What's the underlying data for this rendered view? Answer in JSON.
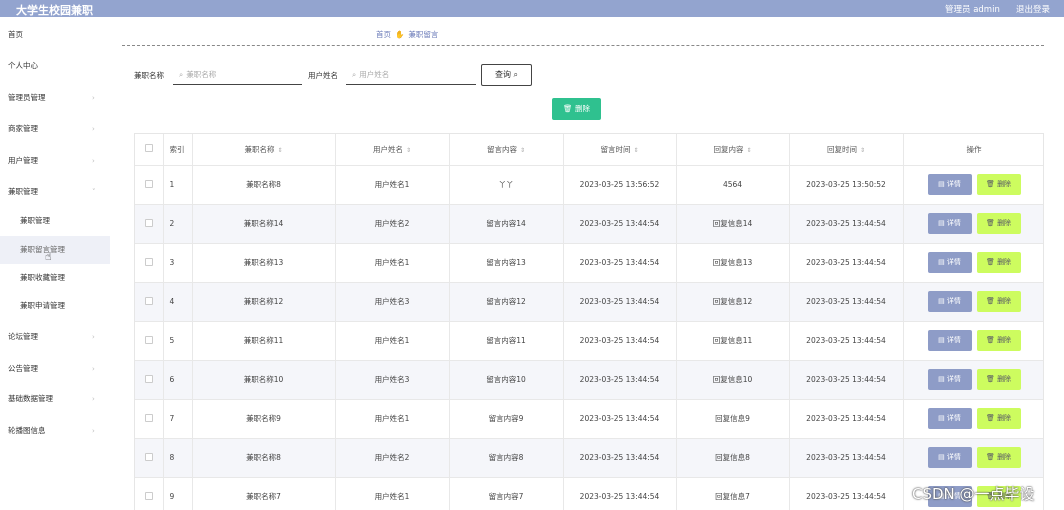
{
  "topbar": {
    "title": "大学生校园兼职",
    "admin": "管理员 admin",
    "logout": "退出登录"
  },
  "sidebar": {
    "items": [
      {
        "label": "首页"
      },
      {
        "label": "个人中心"
      },
      {
        "label": "管理员管理"
      },
      {
        "label": "商家管理"
      },
      {
        "label": "用户管理"
      },
      {
        "label": "兼职管理"
      }
    ],
    "sub_items": [
      {
        "label": "兼职管理"
      },
      {
        "label": "兼职留言管理"
      },
      {
        "label": "兼职收藏管理"
      },
      {
        "label": "兼职申请管理"
      }
    ],
    "bottom_items": [
      {
        "label": "论坛管理"
      },
      {
        "label": "公告管理"
      },
      {
        "label": "基础数据管理"
      },
      {
        "label": "轮播图信息"
      }
    ]
  },
  "breadcrumb": {
    "home": "首页",
    "current": "兼职留言"
  },
  "search": {
    "name_label": "兼职名称",
    "name_placeholder": "兼职名称",
    "user_label": "用户姓名",
    "user_placeholder": "用户姓名",
    "query_button": "查询"
  },
  "toolbar": {
    "delete_label": "删除"
  },
  "table": {
    "headers": [
      "索引",
      "兼职名称",
      "用户姓名",
      "留言内容",
      "留言时间",
      "回复内容",
      "回复时间",
      "操作"
    ],
    "detail_label": "详情",
    "delete_label": "删除",
    "rows": [
      {
        "idx": "1",
        "name": "兼职名称8",
        "user": "用户姓名1",
        "content": "丫丫",
        "time": "2023-03-25 13:56:52",
        "reply": "4564",
        "reply_time": "2023-03-25 13:50:52"
      },
      {
        "idx": "2",
        "name": "兼职名称14",
        "user": "用户姓名2",
        "content": "留言内容14",
        "time": "2023-03-25 13:44:54",
        "reply": "回复信息14",
        "reply_time": "2023-03-25 13:44:54"
      },
      {
        "idx": "3",
        "name": "兼职名称13",
        "user": "用户姓名1",
        "content": "留言内容13",
        "time": "2023-03-25 13:44:54",
        "reply": "回复信息13",
        "reply_time": "2023-03-25 13:44:54"
      },
      {
        "idx": "4",
        "name": "兼职名称12",
        "user": "用户姓名3",
        "content": "留言内容12",
        "time": "2023-03-25 13:44:54",
        "reply": "回复信息12",
        "reply_time": "2023-03-25 13:44:54"
      },
      {
        "idx": "5",
        "name": "兼职名称11",
        "user": "用户姓名1",
        "content": "留言内容11",
        "time": "2023-03-25 13:44:54",
        "reply": "回复信息11",
        "reply_time": "2023-03-25 13:44:54"
      },
      {
        "idx": "6",
        "name": "兼职名称10",
        "user": "用户姓名3",
        "content": "留言内容10",
        "time": "2023-03-25 13:44:54",
        "reply": "回复信息10",
        "reply_time": "2023-03-25 13:44:54"
      },
      {
        "idx": "7",
        "name": "兼职名称9",
        "user": "用户姓名1",
        "content": "留言内容9",
        "time": "2023-03-25 13:44:54",
        "reply": "回复信息9",
        "reply_time": "2023-03-25 13:44:54"
      },
      {
        "idx": "8",
        "name": "兼职名称8",
        "user": "用户姓名2",
        "content": "留言内容8",
        "time": "2023-03-25 13:44:54",
        "reply": "回复信息8",
        "reply_time": "2023-03-25 13:44:54"
      },
      {
        "idx": "9",
        "name": "兼职名称7",
        "user": "用户姓名1",
        "content": "留言内容7",
        "time": "2023-03-25 13:44:54",
        "reply": "回复信息7",
        "reply_time": "2023-03-25 13:44:54"
      }
    ]
  },
  "watermark": "CSDN @一点毕设",
  "colors": {
    "topbar": "#93a4cf",
    "delete_top": "#2fc18f",
    "detail_button": "#8e9cc7",
    "delete_button": "#cdfc5f"
  }
}
